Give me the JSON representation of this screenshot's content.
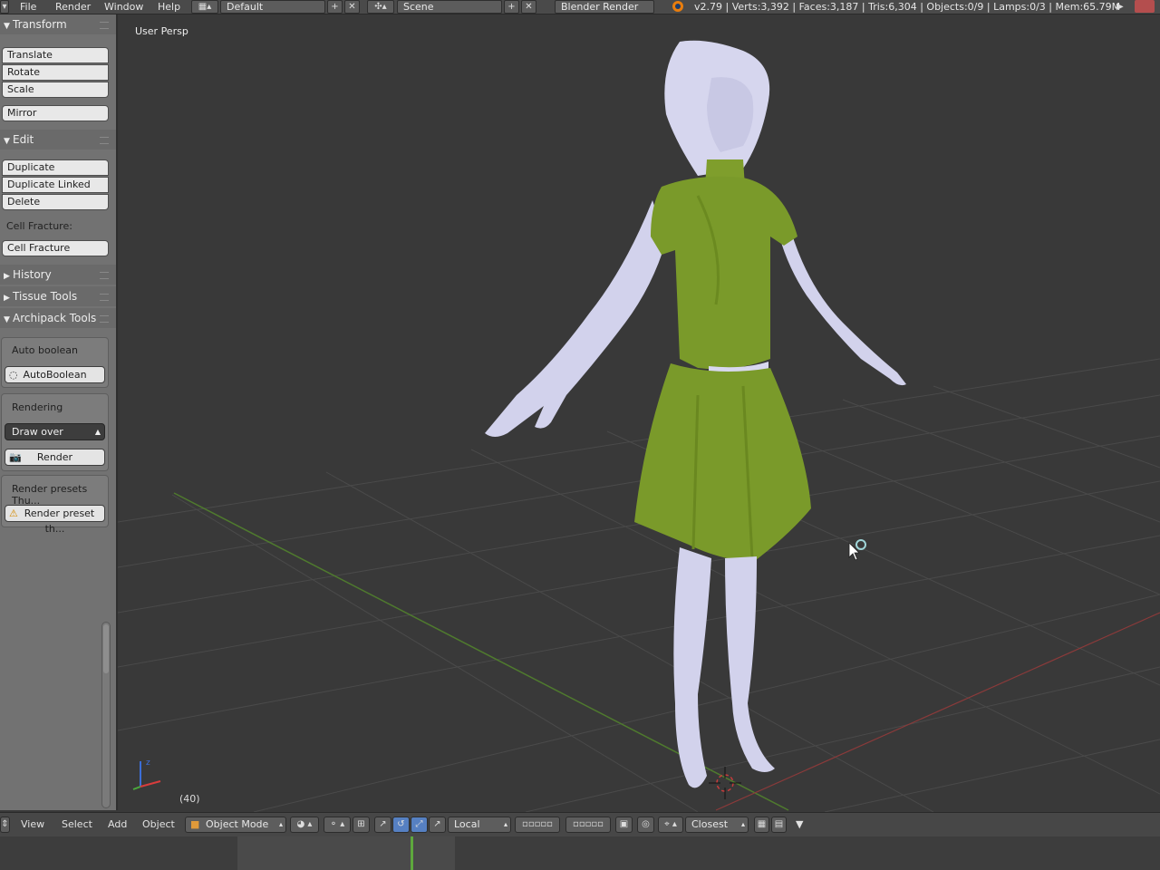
{
  "topbar": {
    "menus": [
      "File",
      "Render",
      "Window",
      "Help"
    ],
    "screen_layout": "Default",
    "scene": "Scene",
    "render_engine": "Blender Render",
    "stats": "v2.79 | Verts:3,392 | Faces:3,187 | Tris:6,304 | Objects:0/9 | Lamps:0/3 | Mem:65.79M"
  },
  "toolshelf": {
    "transform": {
      "title": "Transform",
      "buttons": [
        "Translate",
        "Rotate",
        "Scale",
        "Mirror"
      ]
    },
    "edit": {
      "title": "Edit",
      "buttons": [
        "Duplicate",
        "Duplicate Linked",
        "Delete"
      ],
      "cell_fracture_label": "Cell Fracture:",
      "cell_fracture_button": "Cell Fracture"
    },
    "history": {
      "title": "History"
    },
    "tissue": {
      "title": "Tissue Tools"
    },
    "archipack": {
      "title": "Archipack Tools",
      "auto_boolean_label": "Auto boolean",
      "auto_boolean_button": "AutoBoolean",
      "rendering_label": "Rendering",
      "draw_mode": "Draw over",
      "render_button": "Render",
      "presets_label": "Render presets Thu...",
      "preset_button": "Render preset th..."
    }
  },
  "viewport": {
    "view_label": "User Persp",
    "frame": "(40)"
  },
  "header3d": {
    "menus": [
      "View",
      "Select",
      "Add",
      "Object"
    ],
    "mode": "Object Mode",
    "transform_orientation": "Local",
    "snap_target": "Closest"
  },
  "colors": {
    "accent_blue": "#5680c2",
    "timeline_cursor": "#5ea83d",
    "dress": "#7a9a2a",
    "skin": "#d0d0ea"
  }
}
